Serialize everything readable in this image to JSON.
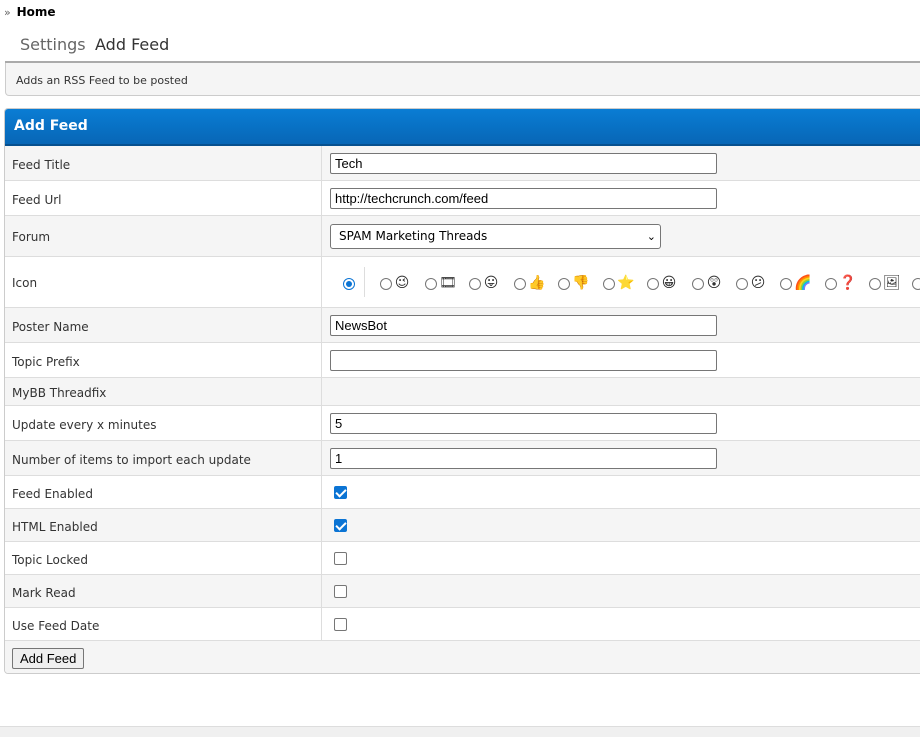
{
  "breadcrumb": {
    "separator": "»",
    "home": "Home"
  },
  "tabs": [
    {
      "label": "Settings"
    },
    {
      "label": "Add Feed"
    }
  ],
  "description": "Adds an RSS Feed to be posted",
  "panel": {
    "title": "Add Feed"
  },
  "fields": {
    "feed_title": {
      "label": "Feed Title",
      "value": "Tech"
    },
    "feed_url": {
      "label": "Feed Url",
      "value": "http://techcrunch.com/feed"
    },
    "forum": {
      "label": "Forum",
      "value": "SPAM Marketing Threads"
    },
    "icon": {
      "label": "Icon",
      "selected": "none",
      "options": [
        "wink-icon",
        "film-icon",
        "tongue-icon",
        "thumbs-up-icon",
        "thumbs-down-icon",
        "star-icon",
        "grin-icon",
        "shocked-icon",
        "confused-icon",
        "rainbow-icon",
        "question-icon",
        "picture-icon"
      ]
    },
    "poster_name": {
      "label": "Poster Name",
      "value": "NewsBot"
    },
    "topic_prefix": {
      "label": "Topic Prefix",
      "value": ""
    },
    "mybb_threadfix": {
      "label": "MyBB Threadfix"
    },
    "update_minutes": {
      "label": "Update every x minutes",
      "value": "5"
    },
    "items_import": {
      "label": "Number of items to import each update",
      "value": "1"
    },
    "feed_enabled": {
      "label": "Feed Enabled",
      "checked": true
    },
    "html_enabled": {
      "label": "HTML Enabled",
      "checked": true
    },
    "topic_locked": {
      "label": "Topic Locked",
      "checked": false
    },
    "mark_read": {
      "label": "Mark Read",
      "checked": false
    },
    "use_feed_date": {
      "label": "Use Feed Date",
      "checked": false
    }
  },
  "submit": {
    "label": "Add Feed"
  },
  "colors": {
    "header": "#0766b6",
    "checkbox": "#0b74d4"
  }
}
